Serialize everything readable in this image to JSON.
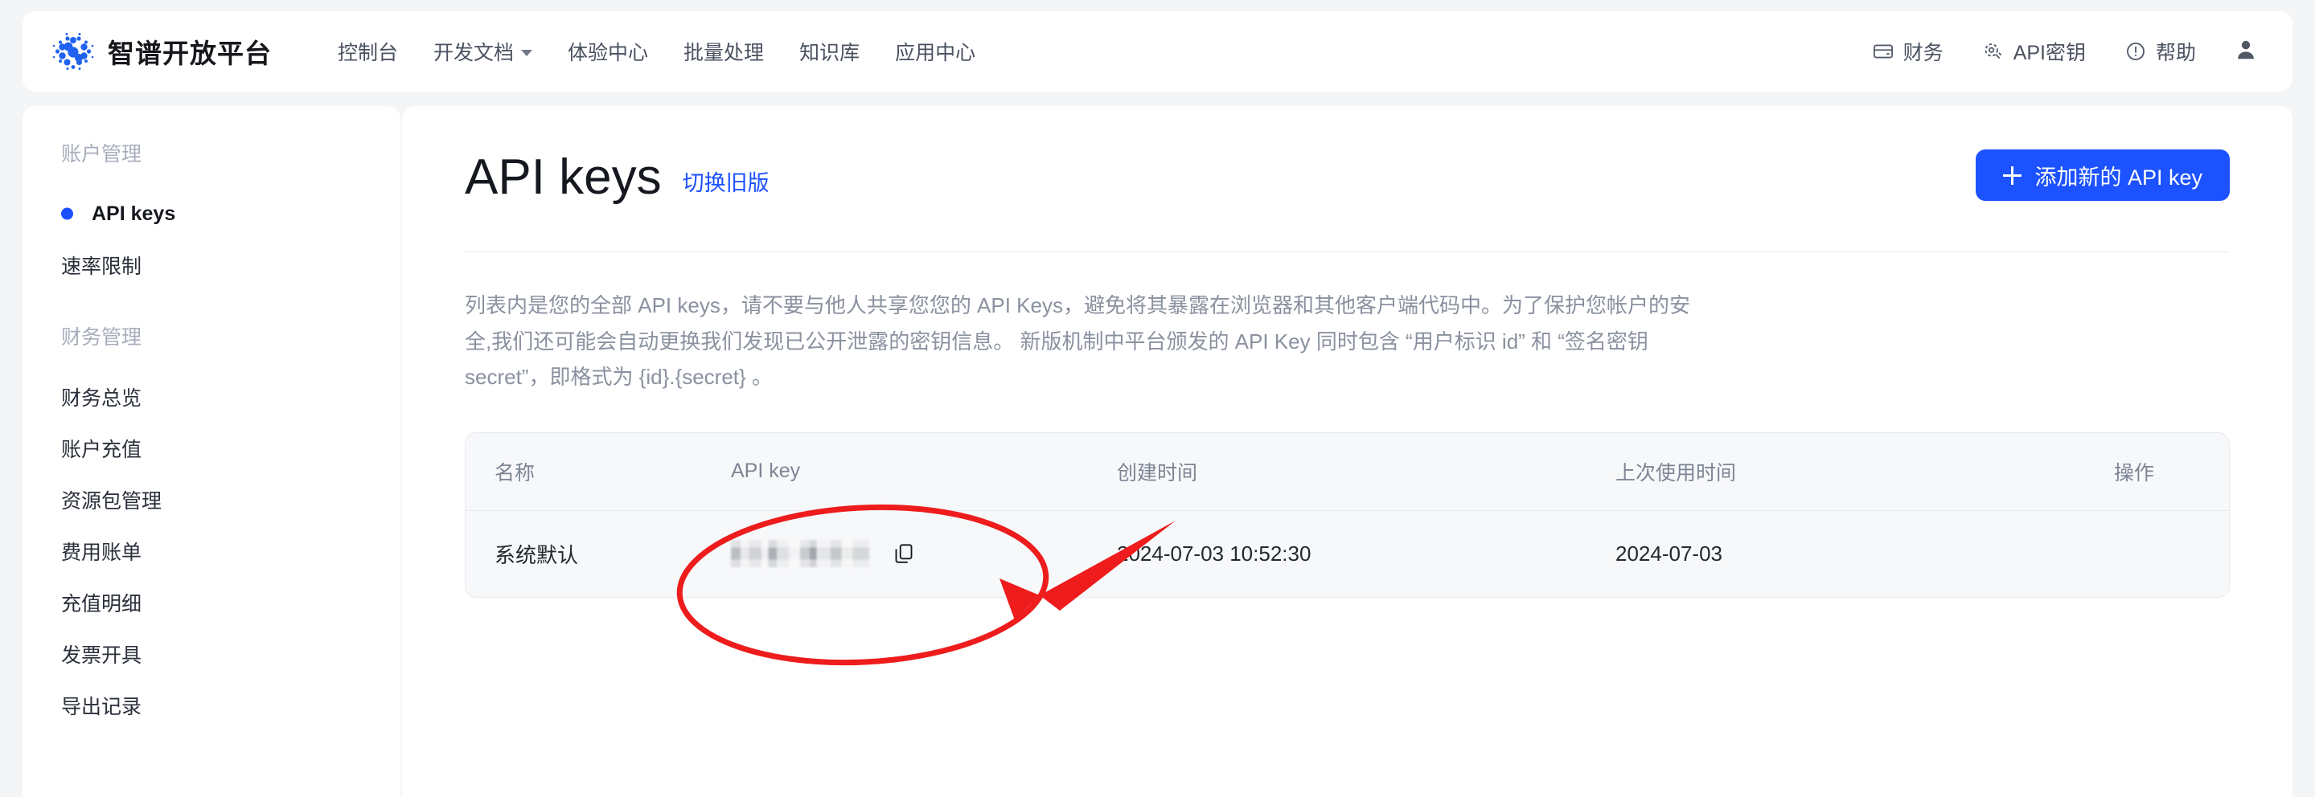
{
  "brand": {
    "name": "智谱开放平台",
    "logo_icon": "zhipu-dots-logo"
  },
  "nav": {
    "links": [
      {
        "label": "控制台",
        "has_dropdown": false
      },
      {
        "label": "开发文档",
        "has_dropdown": true
      },
      {
        "label": "体验中心",
        "has_dropdown": false
      },
      {
        "label": "批量处理",
        "has_dropdown": false
      },
      {
        "label": "知识库",
        "has_dropdown": false
      },
      {
        "label": "应用中心",
        "has_dropdown": false
      }
    ],
    "actions": [
      {
        "label": "财务",
        "icon": "wallet-icon"
      },
      {
        "label": "API密钥",
        "icon": "key-icon"
      },
      {
        "label": "帮助",
        "icon": "info-circle-icon"
      }
    ],
    "avatar_icon": "user-avatar-icon"
  },
  "sidebar": {
    "groups": [
      {
        "title": "账户管理",
        "items": [
          {
            "label": "API keys",
            "active": true
          },
          {
            "label": "速率限制",
            "active": false
          }
        ]
      },
      {
        "title": "财务管理",
        "items": [
          {
            "label": "财务总览",
            "active": false
          },
          {
            "label": "账户充值",
            "active": false
          },
          {
            "label": "资源包管理",
            "active": false
          },
          {
            "label": "费用账单",
            "active": false
          },
          {
            "label": "充值明细",
            "active": false
          },
          {
            "label": "发票开具",
            "active": false
          },
          {
            "label": "导出记录",
            "active": false
          }
        ]
      }
    ]
  },
  "main": {
    "title": "API keys",
    "legacy_link": "切换旧版",
    "add_button": "添加新的 API key",
    "add_button_icon": "plus-icon",
    "description": "列表内是您的全部 API keys，请不要与他人共享您您的 API Keys，避免将其暴露在浏览器和其他客户端代码中。为了保护您帐户的安全,我们还可能会自动更换我们发现已公开泄露的密钥信息。 新版机制中平台颁发的 API Key 同时包含 “用户标识 id” 和 “签名密钥 secret”，即格式为 {id}.{secret} 。",
    "table": {
      "columns": [
        "名称",
        "API key",
        "创建时间",
        "上次使用时间",
        "操作"
      ],
      "rows": [
        {
          "name": "系统默认",
          "api_key": "",
          "api_key_masked": true,
          "copy_icon": "copy-icon",
          "created_at": "2024-07-03 10:52:30",
          "last_used_at": "2024-07-03",
          "actions": ""
        }
      ]
    }
  },
  "annotation": {
    "color": "#ee1c1c",
    "shapes": [
      "ellipse-around-api-key-column",
      "arrow-pointing-to-copy-icon"
    ]
  },
  "colors": {
    "accent_blue": "#1c52ff",
    "page_bg": "#f4f5f7",
    "panel_bg": "#ffffff",
    "table_bg": "#f7f8fa",
    "annotation_red": "#ee1c1c"
  }
}
